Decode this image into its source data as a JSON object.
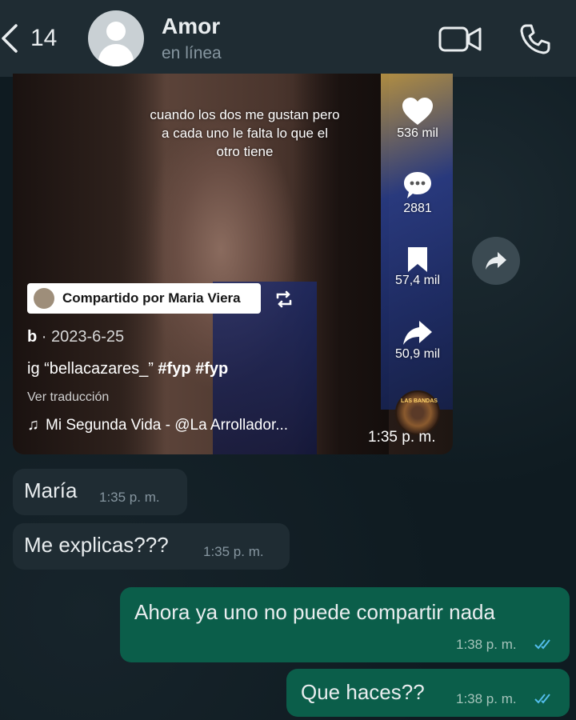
{
  "header": {
    "back_count": "14",
    "contact_name": "Amor",
    "contact_status": "en línea"
  },
  "video_card": {
    "overlay_text": "cuando los dos me gustan pero a cada uno le falta lo que el otro tiene",
    "likes": "536 mil",
    "comments": "2881",
    "saves": "57,4 mil",
    "shares": "50,9 mil",
    "shared_by": "Compartido por Maria Viera",
    "author": "b",
    "date": "2023-6-25",
    "caption_prefix": "ig “bellacazares_”",
    "caption_tags": "#fyp #fyp",
    "translate": "Ver traducción",
    "music": "Mi Segunda Vida - @La Arrollador...",
    "disc_text": "LAS BANDAS",
    "time": "1:35 p. m."
  },
  "messages": [
    {
      "direction": "in",
      "text": "María",
      "time": "1:35 p. m."
    },
    {
      "direction": "in",
      "text": "Me explicas???",
      "time": "1:35 p. m."
    },
    {
      "direction": "out",
      "text": "Ahora ya uno no puede compartir nada",
      "time": "1:38 p. m."
    },
    {
      "direction": "out",
      "text": "Que haces??",
      "time": "1:38 p. m."
    }
  ],
  "colors": {
    "header_bg": "#1f2c33",
    "incoming_bubble": "#1f2c33",
    "outgoing_bubble": "#0b5e4a",
    "read_ticks": "#53bdeb"
  },
  "icons": [
    "back-chevron-icon",
    "avatar-icon",
    "video-call-icon",
    "voice-call-icon",
    "heart-icon",
    "comment-icon",
    "bookmark-icon",
    "share-icon",
    "repost-icon",
    "music-note-icon",
    "forward-icon",
    "double-check-icon"
  ]
}
